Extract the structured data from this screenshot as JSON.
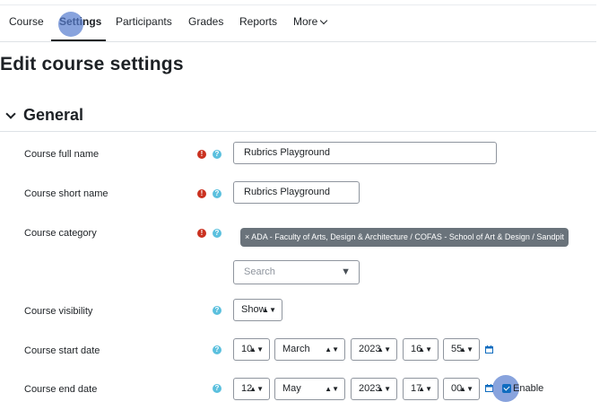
{
  "nav": {
    "tabs": [
      {
        "label": "Course"
      },
      {
        "label": "Settings",
        "active": true
      },
      {
        "label": "Participants"
      },
      {
        "label": "Grades"
      },
      {
        "label": "Reports"
      },
      {
        "label": "More"
      }
    ]
  },
  "page": {
    "title": "Edit course settings"
  },
  "section": {
    "title": "General",
    "state": "expanded"
  },
  "form": {
    "required_icon": "exclamation-circle-icon",
    "help_icon": "question-circle-icon",
    "full_name": {
      "label": "Course full name",
      "value": "Rubrics Playground"
    },
    "short_name": {
      "label": "Course short name",
      "value": "Rubrics Playground"
    },
    "category": {
      "label": "Course category",
      "selected": "ADA - Faculty of Arts, Design & Architecture / COFAS - School of Art & Design / Sandpit",
      "remove_symbol": "×",
      "search_placeholder": "Search"
    },
    "visibility": {
      "label": "Course visibility",
      "value": "Show"
    },
    "start_date": {
      "label": "Course start date",
      "day": "10",
      "month": "March",
      "year": "2023",
      "hour": "16",
      "minute": "55"
    },
    "end_date": {
      "label": "Course end date",
      "day": "12",
      "month": "May",
      "year": "2023",
      "hour": "17",
      "minute": "00",
      "enable_label": "Enable",
      "enabled": true
    }
  },
  "colors": {
    "accent": "#0f6cbf",
    "required": "#ca3120",
    "help": "#5bc0de",
    "tag": "#6a737b",
    "click_marker": "#567cce"
  }
}
